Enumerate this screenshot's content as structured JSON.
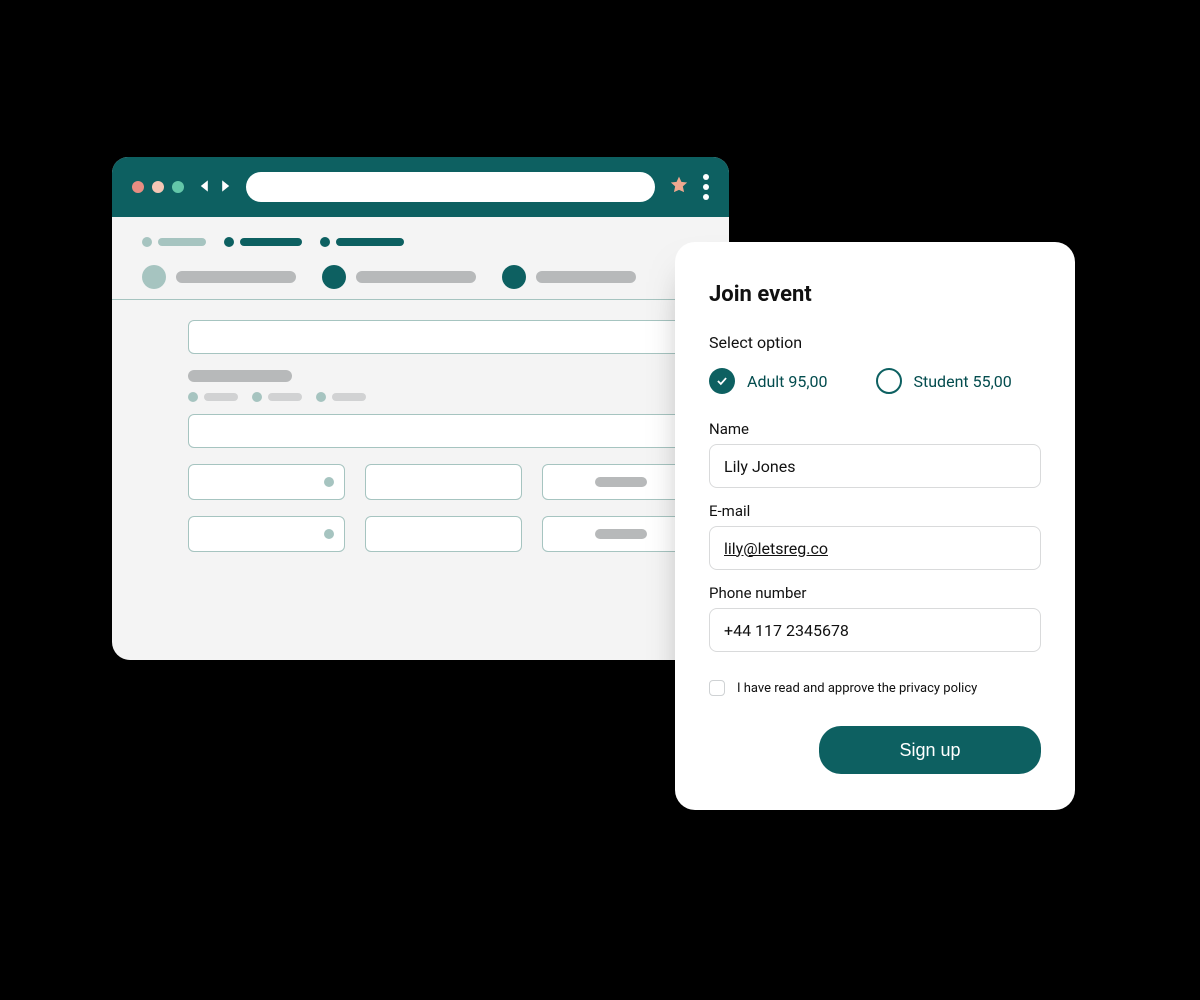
{
  "browser": {
    "traffic_colors": {
      "close": "#e88d82",
      "minimize": "#f5c6b5",
      "zoom": "#63c7a9"
    },
    "address_value": "",
    "favorite_icon": "star-icon",
    "menu_icon": "kebab-menu-icon"
  },
  "panel": {
    "title": "Join event",
    "select_label": "Select option",
    "options": [
      {
        "label": "Adult 95,00",
        "price": 95.0,
        "selected": true
      },
      {
        "label": "Student 55,00",
        "price": 55.0,
        "selected": false
      }
    ],
    "name_label": "Name",
    "name_value": "Lily Jones",
    "email_label": "E-mail",
    "email_value": "lily@letsreg.co",
    "phone_label": "Phone number",
    "phone_value": "+44 117 2345678",
    "privacy_label": "I have read and approve the privacy policy",
    "privacy_checked": false,
    "signup_label": "Sign up"
  },
  "colors": {
    "accent": "#0d6061",
    "accent_soft": "#a6c4c0",
    "page_bg": "#f4f4f4"
  }
}
